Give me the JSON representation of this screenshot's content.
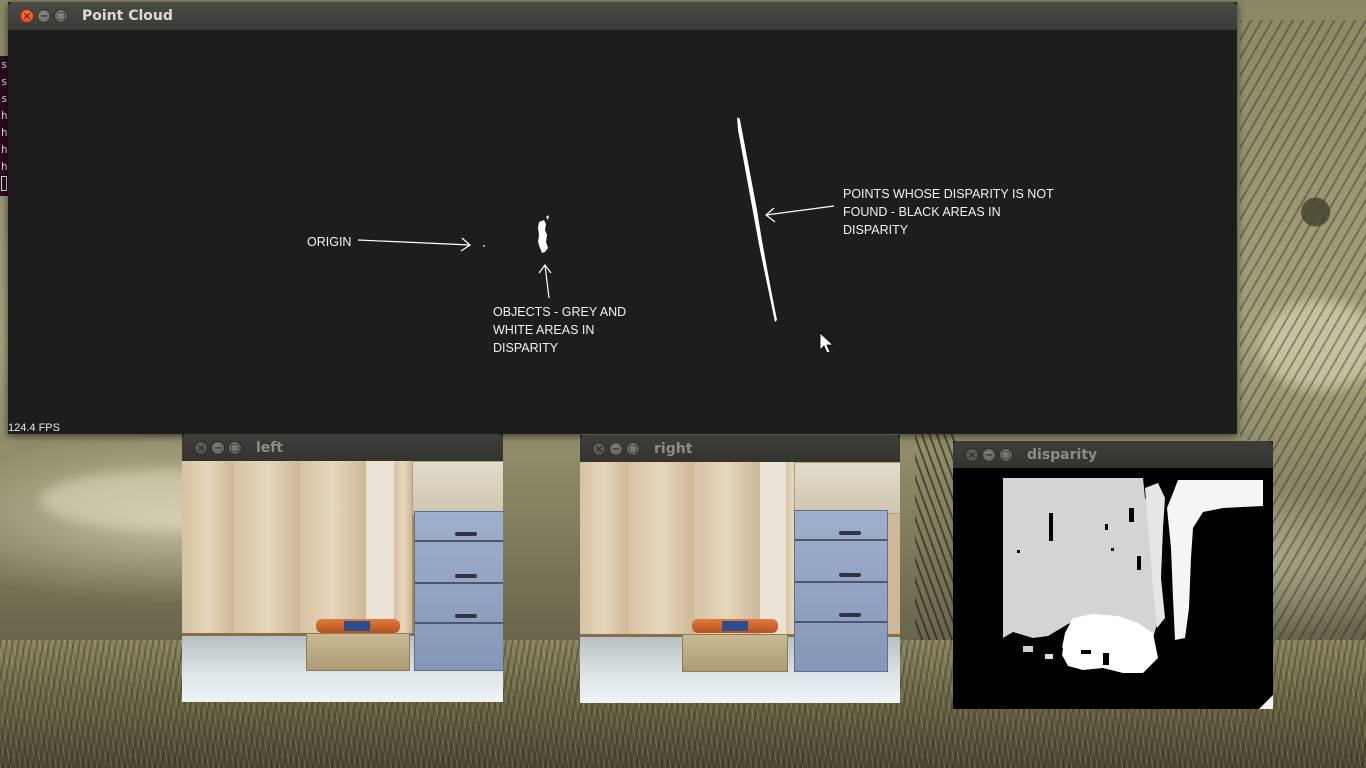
{
  "desktop": {
    "terminal_lines": [
      "s",
      "s",
      "s",
      "h",
      "h",
      "h",
      "h"
    ]
  },
  "point_cloud_window": {
    "title": "Point Cloud",
    "fps": "124.4 FPS",
    "annotations": {
      "origin": "ORIGIN",
      "objects": "OBJECTS - GREY AND\nWHITE AREAS IN\nDISPARITY",
      "not_found": "POINTS WHOSE DISPARITY IS NOT\nFOUND - BLACK AREAS IN\nDISPARITY"
    },
    "colors": {
      "background": "#1d1d1d",
      "foreground": "#ffffff"
    }
  },
  "left_window": {
    "title": "left"
  },
  "right_window": {
    "title": "right"
  },
  "disparity_window": {
    "title": "disparity"
  },
  "window_buttons": {
    "close": "×",
    "minimize": "−",
    "maximize": "□"
  }
}
